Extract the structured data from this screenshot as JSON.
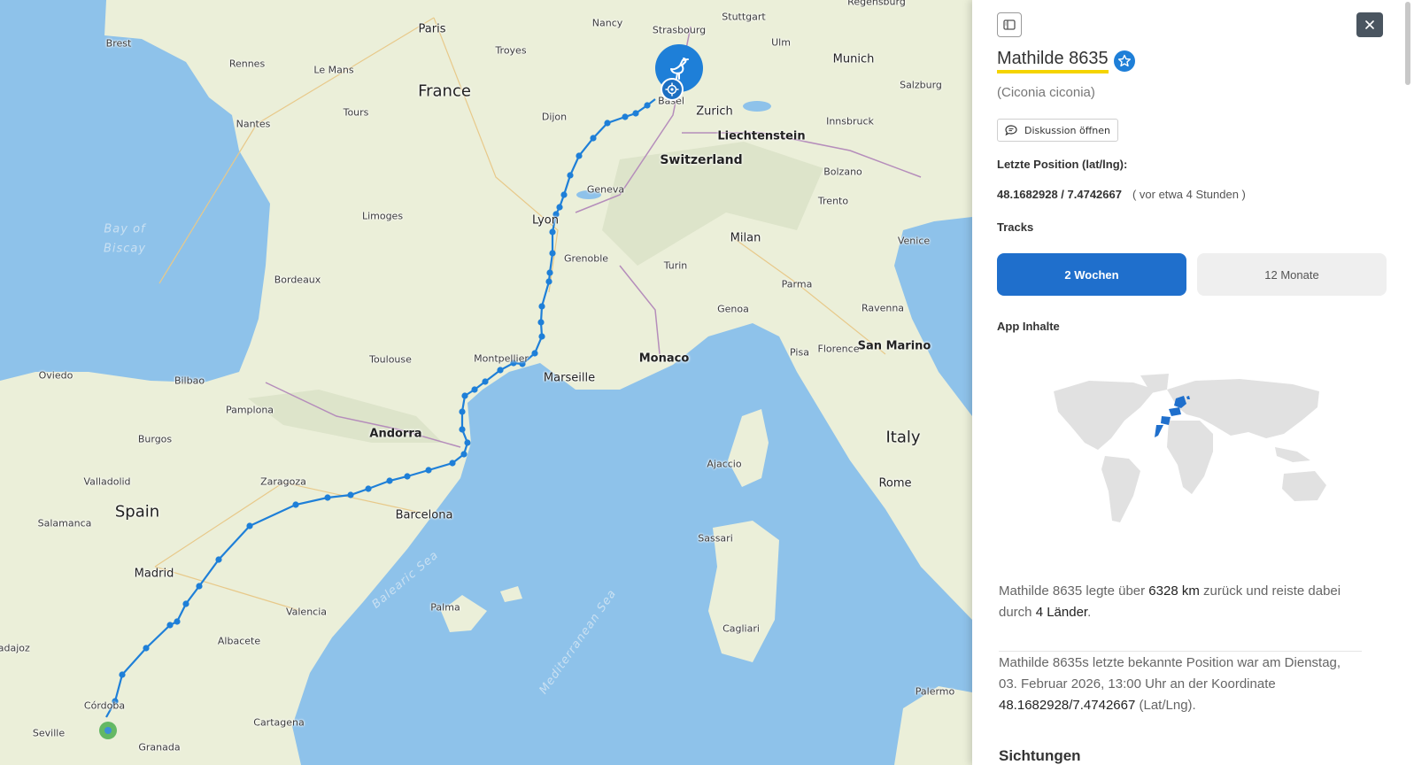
{
  "map": {
    "countries": [
      {
        "id": "france",
        "label": "France"
      },
      {
        "id": "switzerland",
        "label": "Switzerland"
      },
      {
        "id": "liechtenstein",
        "label": "Liechtenstein"
      },
      {
        "id": "spain",
        "label": "Spain"
      },
      {
        "id": "italy",
        "label": "Italy"
      },
      {
        "id": "andorra",
        "label": "Andorra"
      },
      {
        "id": "monaco",
        "label": "Monaco"
      },
      {
        "id": "san-marino",
        "label": "San Marino"
      }
    ],
    "seas": {
      "bay_of_biscay": [
        "Bay of",
        "Biscay"
      ],
      "balearic_sea": "Balearic Sea",
      "mediterranean_sea": "Mediterranean Sea"
    },
    "cities": [
      "Paris",
      "Brest",
      "Rennes",
      "Le Mans",
      "Nantes",
      "Tours",
      "Troyes",
      "Nancy",
      "Strasbourg",
      "Stuttgart",
      "Ulm",
      "Munich",
      "Regensburg",
      "Salzburg",
      "Innsbruck",
      "Bolzano",
      "Trento",
      "Venice",
      "Milan",
      "Turin",
      "Parma",
      "Genoa",
      "Pisa",
      "Ravenna",
      "Florence",
      "Rome",
      "Basel",
      "Zurich",
      "Dijon",
      "Geneva",
      "Lyon",
      "Grenoble",
      "Limoges",
      "Bordeaux",
      "Toulouse",
      "Montpellier",
      "Marseille",
      "Oviedo",
      "Bilbao",
      "Pamplona",
      "Burgos",
      "Valladolid",
      "Zaragoza",
      "Barcelona",
      "Salamanca",
      "Madrid",
      "Valencia",
      "Albacete",
      "Córdoba",
      "Seville",
      "Granada",
      "Cartagena",
      "Palma",
      "Ajaccio",
      "Sassari",
      "Cagliari",
      "Palermo",
      "Badajoz"
    ]
  },
  "icons": {
    "stork": "stork-icon",
    "locate": "crosshair-icon",
    "sidebar": "sidebar-toggle-icon",
    "close": "close-icon",
    "star": "star-badge-icon",
    "chat": "chat-bubble-icon"
  },
  "panel": {
    "title": "Mathilde 8635",
    "species": "(Ciconia ciconia)",
    "discuss_label": "Diskussion öffnen",
    "last_position_label": "Letzte Position (lat/lng):",
    "coordinates": "48.1682928 / 7.4742667",
    "time_ago": "( vor etwa 4 Stunden )",
    "tracks_label": "Tracks",
    "tabs": [
      {
        "label": "2 Wochen",
        "active": true
      },
      {
        "label": "12 Monate",
        "active": false
      }
    ],
    "app_content_label": "App Inhalte",
    "summary1": {
      "a": "Mathilde 8635 legte über ",
      "distance": "6328 km",
      "b": " zurück und reiste dabei durch ",
      "countries": "4 Länder",
      "c": "."
    },
    "summary2": {
      "a": "Mathilde 8635s letzte bekannte Position war am Dienstag, 03. Februar 2026, 13:00 Uhr an der Koordinate ",
      "coords": "48.1682928/7.4742667",
      "b": " (Lat/Lng)."
    },
    "sightings_label": "Sichtungen"
  },
  "colors": {
    "accent": "#1f6fcc",
    "track": "#1e7fd8",
    "highlight": "#f5d400",
    "sea": "#8ec2ea",
    "land": "#ebefd9",
    "start": "#4caf50"
  }
}
